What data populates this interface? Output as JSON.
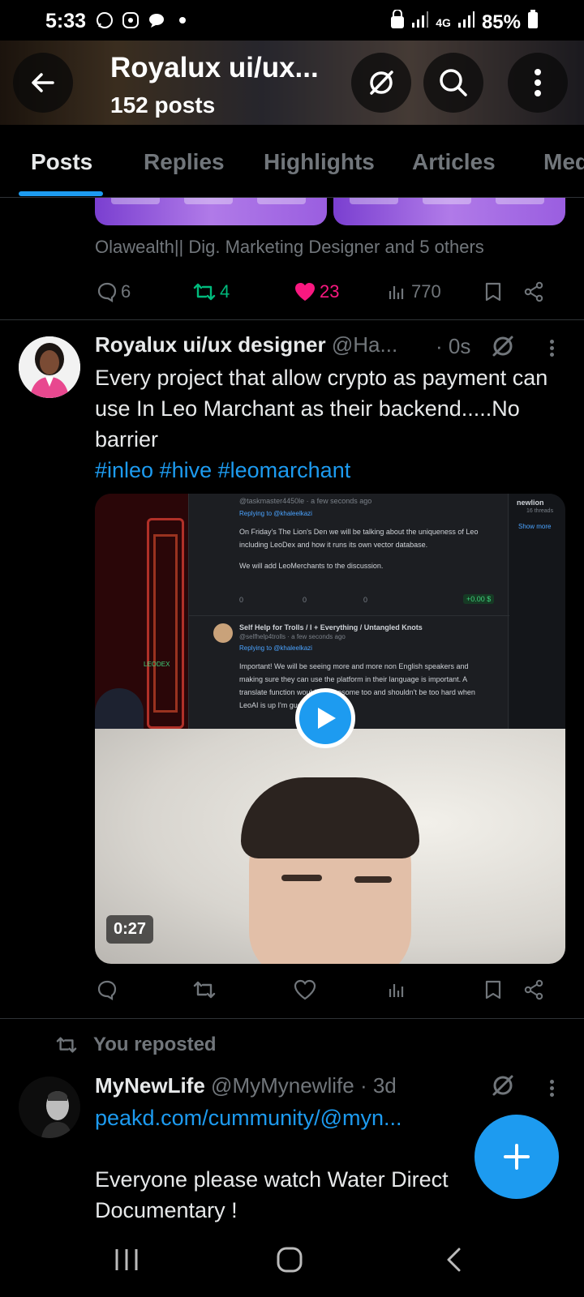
{
  "status_bar": {
    "time": "5:33",
    "network": "4G",
    "battery": "85%"
  },
  "header": {
    "title": "Royalux ui/ux...",
    "post_count": "152 posts"
  },
  "tabs": [
    {
      "label": "Posts",
      "active": true
    },
    {
      "label": "Replies",
      "active": false
    },
    {
      "label": "Highlights",
      "active": false
    },
    {
      "label": "Articles",
      "active": false
    },
    {
      "label": "Media",
      "active": false
    }
  ],
  "post1": {
    "liked_by": "Olawealth|| Dig. Marketing Designer and 5 others",
    "replies": "6",
    "reposts": "4",
    "likes": "23",
    "views": "770"
  },
  "post2": {
    "name": "Royalux ui/ux designer",
    "handle": "@Ha...",
    "time": "· 0s",
    "text": "Every project that allow crypto as payment can use In Leo Marchant as their backend.....No barrier",
    "hashtags": "#inleo #hive #leomarchant",
    "video_duration": "0:27",
    "embedded": {
      "handle1": "@taskmaster4450le · a few seconds ago",
      "replying1": "Replying to @khaleelkazi",
      "text1a": "On Friday's The Lion's Den we will be talking about the uniqueness of Leo",
      "text1b": "including LeoDex and how it runs its own vector database.",
      "text1c": "We will add LeoMerchants to the discussion.",
      "counts": [
        "0",
        "0",
        "0"
      ],
      "tip": "+0.00 $",
      "name2": "Self Help for Trolls / I + Everything / Untangled Knots",
      "handle2": "@selfhelp4trolls · a few seconds ago",
      "replying2": "Replying to @khaleelkazi",
      "text2a": "Important! We will be seeing more and more non English speakers and",
      "text2b": "making sure they can use the platform in their language is important. A",
      "text2c": "translate function would be awesome too and shouldn't be too hard when",
      "text2d": "LeoAI is up I'm gue...",
      "side_tag": "newlion",
      "side_sub": "16 threads",
      "side_more": "Show more",
      "brand": "LEODEX"
    }
  },
  "repost_notice": "You reposted",
  "post3": {
    "name": "MyNewLife",
    "handle": "@MyMynewlife",
    "time": "· 3d",
    "link": "peakd.com/cummunity/@myn...",
    "text": "Everyone please watch Water Direct Documentary !"
  },
  "colors": {
    "accent": "#1d9bf0",
    "like": "#f91880",
    "repost": "#00ba7c",
    "muted": "#71767b"
  }
}
